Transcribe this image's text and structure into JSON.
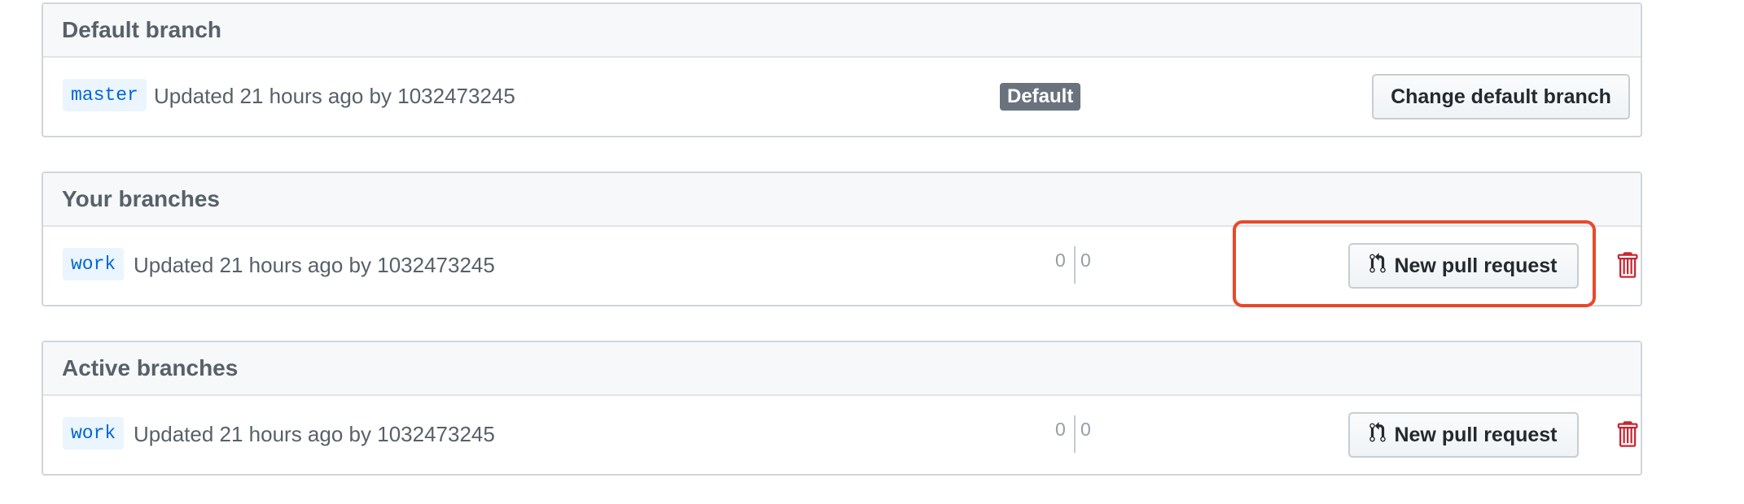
{
  "default_branch": {
    "heading": "Default branch",
    "branch_name": "master",
    "updated_text": "Updated 21 hours ago by",
    "author": "1032473245",
    "badge": "Default",
    "action_label": "Change default branch"
  },
  "your_branches": {
    "heading": "Your branches",
    "rows": [
      {
        "branch_name": "work",
        "updated_text": "Updated 21 hours ago by",
        "author": "1032473245",
        "behind": "0",
        "ahead": "0",
        "action_label": "New pull request",
        "delete_icon": "trash-icon"
      }
    ]
  },
  "active_branches": {
    "heading": "Active branches",
    "rows": [
      {
        "branch_name": "work",
        "updated_text": "Updated 21 hours ago by",
        "author": "1032473245",
        "behind": "0",
        "ahead": "0",
        "action_label": "New pull request",
        "delete_icon": "trash-icon"
      }
    ]
  },
  "colors": {
    "link": "#0366d6",
    "danger": "#cb2431",
    "highlight": "#e8492b",
    "badge": "#6a737d"
  }
}
